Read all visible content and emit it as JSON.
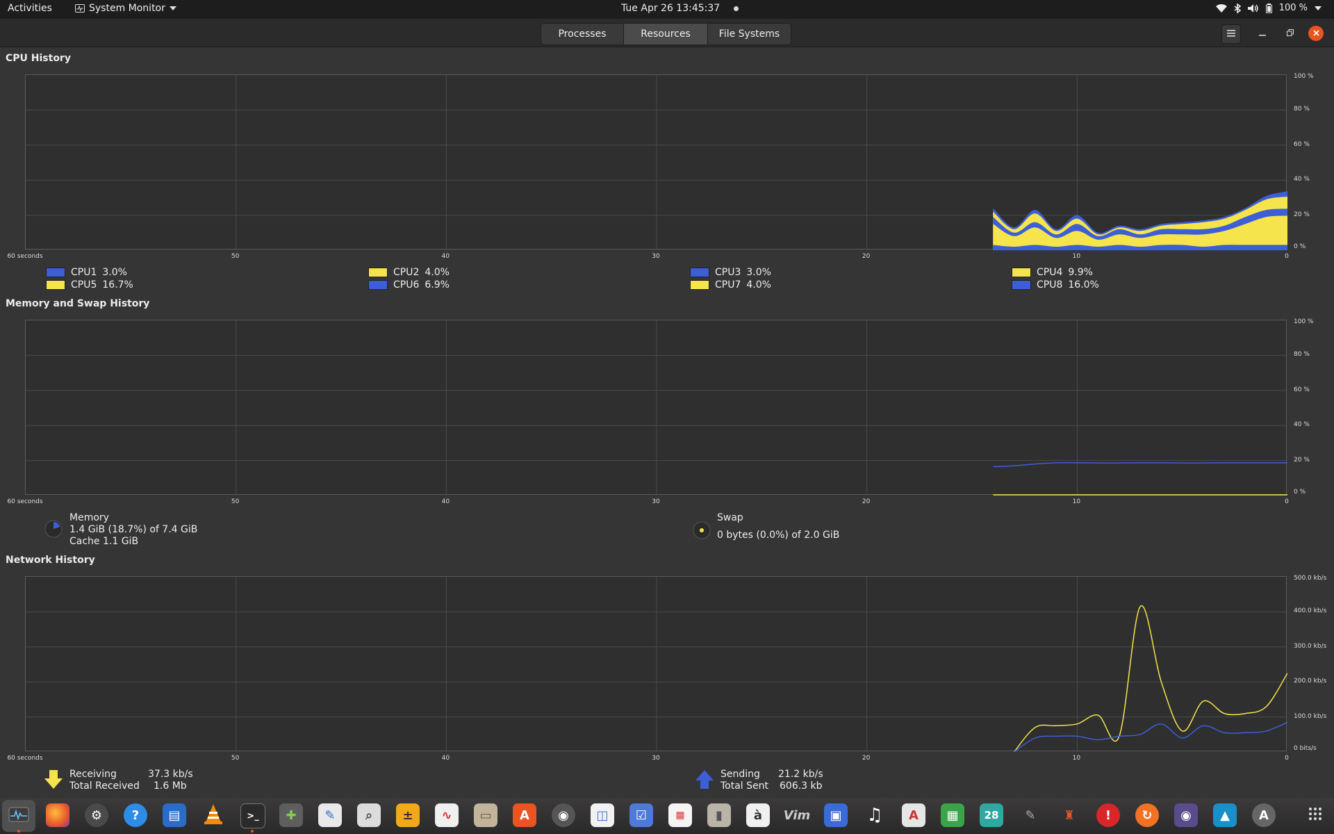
{
  "topbar": {
    "activities": "Activities",
    "app_name": "System Monitor",
    "clock": "Tue Apr 26  13:45:37",
    "battery": "100 %"
  },
  "header": {
    "tabs": [
      "Processes",
      "Resources",
      "File Systems"
    ],
    "active_tab": "Resources"
  },
  "cpu": {
    "title": "CPU History",
    "x_labels": [
      "60 seconds",
      "50",
      "40",
      "30",
      "20",
      "10",
      "0"
    ],
    "y_labels": [
      "100 %",
      "80 %",
      "60 %",
      "40 %",
      "20 %",
      "0 %"
    ],
    "legend": [
      {
        "name": "CPU1",
        "value": "3.0%",
        "color": "#3c5fd8"
      },
      {
        "name": "CPU5",
        "value": "16.7%",
        "color": "#f6e44d"
      },
      {
        "name": "CPU2",
        "value": "4.0%",
        "color": "#f6e44d"
      },
      {
        "name": "CPU6",
        "value": "6.9%",
        "color": "#3c5fd8"
      },
      {
        "name": "CPU3",
        "value": "3.0%",
        "color": "#3c5fd8"
      },
      {
        "name": "CPU7",
        "value": "4.0%",
        "color": "#f6e44d"
      },
      {
        "name": "CPU4",
        "value": "9.9%",
        "color": "#f6e44d"
      },
      {
        "name": "CPU8",
        "value": "16.0%",
        "color": "#3c5fd8"
      }
    ]
  },
  "memory": {
    "title": "Memory and Swap History",
    "x_labels": [
      "60 seconds",
      "50",
      "40",
      "30",
      "20",
      "10",
      "0"
    ],
    "y_labels": [
      "100 %",
      "80 %",
      "60 %",
      "40 %",
      "20 %",
      "0 %"
    ],
    "memory_label": "Memory",
    "memory_used": "1.4 GiB (18.7%) of 7.4 GiB",
    "cache": "Cache 1.1 GiB",
    "swap_label": "Swap",
    "swap_used": "0 bytes (0.0%) of 2.0 GiB"
  },
  "network": {
    "title": "Network History",
    "x_labels": [
      "60 seconds",
      "50",
      "40",
      "30",
      "20",
      "10",
      "0"
    ],
    "y_labels": [
      "500.0 kb/s",
      "400.0 kb/s",
      "300.0 kb/s",
      "200.0 kb/s",
      "100.0 kb/s",
      "0 bits/s"
    ],
    "receiving_label": "Receiving",
    "receiving_value": "37.3 kb/s",
    "total_received_label": "Total Received",
    "total_received_value": "1.6 Mb",
    "sending_label": "Sending",
    "sending_value": "21.2 kb/s",
    "total_sent_label": "Total Sent",
    "total_sent_value": "606.3 kb"
  },
  "colors": {
    "blue": "#3c5fd8",
    "yellow": "#f6e44d",
    "accent": "#e95420"
  },
  "chart_data": [
    {
      "type": "area",
      "title": "CPU History",
      "xlabel": "",
      "ylabel": "",
      "x": [
        14,
        13,
        12,
        11,
        10,
        9,
        8,
        7,
        6,
        5,
        4,
        3,
        2,
        1,
        0
      ],
      "xlim": [
        60,
        0
      ],
      "ylim": [
        0,
        100
      ],
      "series": [
        {
          "name": "CPU1",
          "values": [
            3,
            2,
            3,
            2,
            3,
            2,
            3,
            2,
            3,
            3,
            2,
            3,
            3,
            3,
            3
          ]
        },
        {
          "name": "CPU5",
          "values": [
            12,
            6,
            10,
            5,
            8,
            4,
            6,
            5,
            6,
            6,
            7,
            8,
            12,
            16,
            16.7
          ]
        },
        {
          "name": "CPU2",
          "values": [
            4,
            2,
            3,
            2,
            4,
            2,
            3,
            2,
            3,
            3,
            3,
            3,
            4,
            4,
            4
          ]
        },
        {
          "name": "CPU6",
          "values": [
            3,
            2,
            5,
            2,
            3,
            1,
            1,
            2,
            2,
            3,
            4,
            4,
            4,
            6,
            6.9
          ]
        },
        {
          "name": "CPU3",
          "values": [
            2,
            1,
            2,
            1,
            2,
            1,
            1,
            1,
            1,
            1,
            1,
            1,
            1,
            2,
            3
          ]
        }
      ]
    },
    {
      "type": "line",
      "title": "Memory and Swap History",
      "xlabel": "",
      "ylabel": "",
      "x": [
        14,
        13,
        12,
        11,
        10,
        9,
        8,
        7,
        6,
        5,
        4,
        3,
        2,
        1,
        0
      ],
      "xlim": [
        60,
        0
      ],
      "ylim": [
        0,
        100
      ],
      "series": [
        {
          "name": "Memory",
          "values": [
            16.5,
            17,
            18,
            18.7,
            18.7,
            18.6,
            18.6,
            18.7,
            18.7,
            18.6,
            18.6,
            18.7,
            18.7,
            18.7,
            18.7
          ]
        },
        {
          "name": "Swap",
          "values": [
            0,
            0,
            0,
            0,
            0,
            0,
            0,
            0,
            0,
            0,
            0,
            0,
            0,
            0,
            0
          ]
        }
      ]
    },
    {
      "type": "line",
      "title": "Network History",
      "xlabel": "",
      "ylabel": "",
      "x": [
        13,
        12,
        11,
        10,
        9,
        8,
        7,
        6,
        5,
        4,
        3,
        2,
        1,
        0
      ],
      "xlim": [
        60,
        0
      ],
      "ylim": [
        0,
        500
      ],
      "series": [
        {
          "name": "Receiving",
          "values": [
            0,
            70,
            75,
            80,
            105,
            45,
            415,
            200,
            60,
            145,
            110,
            110,
            130,
            225
          ]
        },
        {
          "name": "Sending",
          "values": [
            0,
            40,
            45,
            45,
            35,
            45,
            50,
            80,
            40,
            75,
            55,
            55,
            60,
            85
          ]
        }
      ]
    }
  ]
}
